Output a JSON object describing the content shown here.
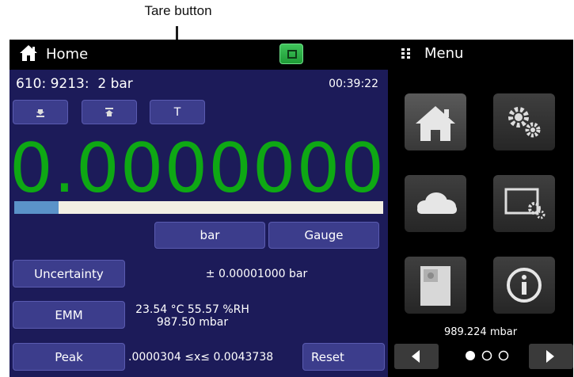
{
  "annotation": {
    "label": "Tare button"
  },
  "header": {
    "home_title": "Home",
    "menu_title": "Menu"
  },
  "main": {
    "sensor_id": "610: 9213:  2 bar",
    "clock": "00:39:22",
    "tare_label": "T",
    "reading": "0.0000000",
    "range_fraction": 0.12,
    "unit_label": "bar",
    "mode_label": "Gauge",
    "uncertainty_label": "Uncertainty",
    "uncertainty_value": "± 0.00001000   bar",
    "emm_label": "EMM",
    "emm_line1": "23.54 °C  55.57 %RH",
    "emm_line2": "987.50 mbar",
    "peak_label": "Peak",
    "peak_value": ".0000304 ≤x≤ 0.0043738",
    "reset_label": "Reset"
  },
  "menu": {
    "tiles": [
      "home-icon",
      "settings-gears-icon",
      "cloud-icon",
      "display-settings-icon",
      "storage-icon",
      "info-icon"
    ],
    "barometer": "989.224 mbar",
    "page_dots": {
      "total": 3,
      "active": 1
    }
  },
  "colors": {
    "main_background": "#1c1b59",
    "reading_green": "#0ea814",
    "button_blue": "#3c3d8c",
    "range_fill": "#5b93c9"
  }
}
